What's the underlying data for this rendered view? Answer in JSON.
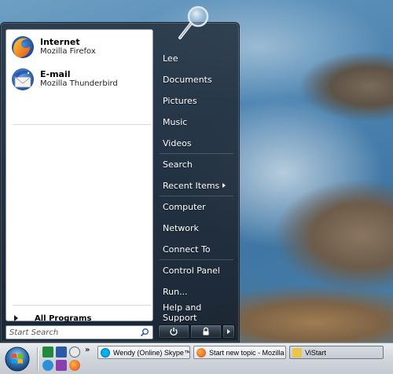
{
  "start_menu": {
    "pinned": [
      {
        "title": "Internet",
        "subtitle": "Mozilla Firefox",
        "icon": "firefox-icon"
      },
      {
        "title": "E-mail",
        "subtitle": "Mozilla Thunderbird",
        "icon": "thunderbird-icon"
      }
    ],
    "all_programs_label": "All Programs",
    "search": {
      "placeholder": "Start Search"
    },
    "right_items": [
      {
        "label": "Lee"
      },
      {
        "label": "Documents"
      },
      {
        "label": "Pictures"
      },
      {
        "label": "Music"
      },
      {
        "label": "Videos"
      },
      {
        "label": "Search"
      },
      {
        "label": "Recent Items"
      },
      {
        "label": "Computer"
      },
      {
        "label": "Network"
      },
      {
        "label": "Connect To"
      },
      {
        "label": "Control Panel"
      },
      {
        "label": "Run..."
      },
      {
        "label": "Help and Support"
      }
    ],
    "power_buttons": [
      "power-icon",
      "lock-icon",
      "arrow-right-icon"
    ]
  },
  "taskbar": {
    "buttons": [
      {
        "label": "Wendy (Online) Skype™ ...",
        "icon": "skype-icon"
      },
      {
        "label": "Start new topic - Mozilla ...",
        "icon": "firefox-icon"
      },
      {
        "label": "ViStart",
        "icon": "folder-icon"
      }
    ],
    "quick_launch": [
      "publisher-icon",
      "word-icon",
      "clock-icon",
      "globe-icon",
      "media-icon",
      "firefox-icon"
    ],
    "overflow_label": "»"
  },
  "colors": {
    "menu_bg": "#1f2b38",
    "left_pane_bg": "#ffffff",
    "taskbar_bg": "#d3d8dd",
    "accent": "#3f76a3"
  }
}
